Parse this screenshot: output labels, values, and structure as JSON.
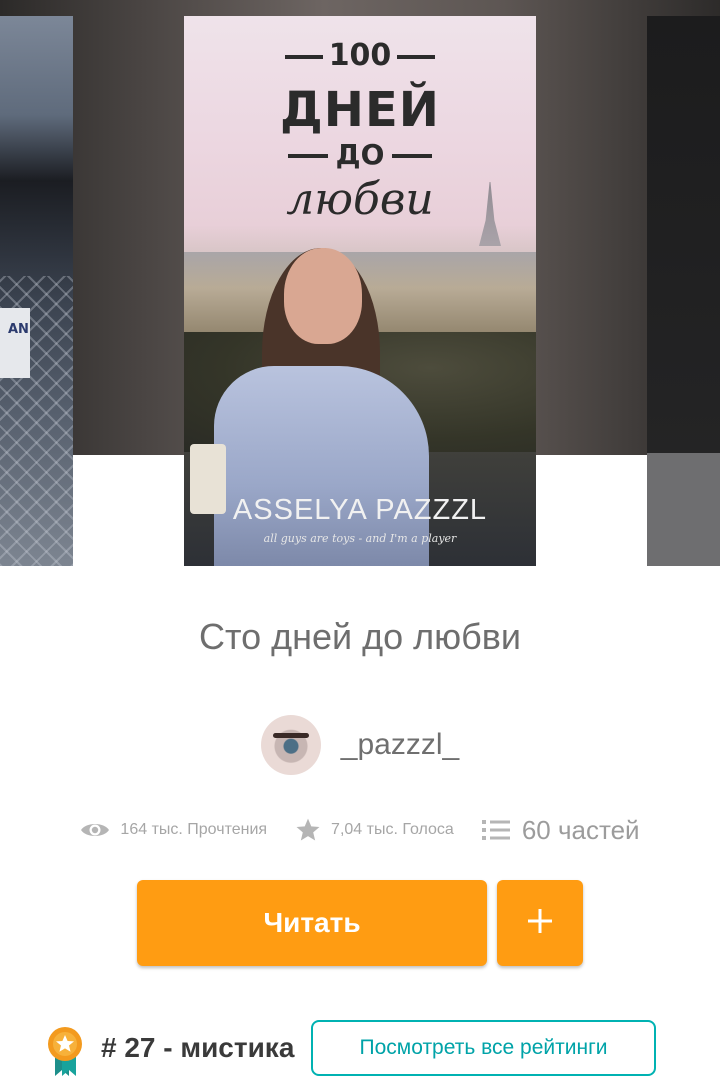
{
  "carousel": {
    "current_cover": {
      "number": "100",
      "line1": "ДНЕЙ",
      "line2": "ДО",
      "line3": "любви",
      "author_on_cover": "ASSELYA PAZZZL",
      "tagline": "all guys are toys - and I'm a player"
    },
    "left_cover": {
      "sign_text": "AN"
    }
  },
  "book": {
    "title": "Сто дней до любви",
    "author": "_pazzzl_"
  },
  "stats": {
    "reads": "164 тыс. Прочтения",
    "votes": "7,04 тыс. Голоса",
    "parts": "60 частей",
    "reads_icon": "eye-icon",
    "votes_icon": "star-icon",
    "parts_icon": "list-icon"
  },
  "actions": {
    "read_label": "Читать",
    "add_label": "+"
  },
  "ranking": {
    "rank_text": "# 27 - мистика",
    "view_all_label": "Посмотреть все рейтинги",
    "badge_icon": "award-badge-icon"
  },
  "colors": {
    "accent_orange": "#ff9c12",
    "ratings_teal": "#00b2b2"
  }
}
